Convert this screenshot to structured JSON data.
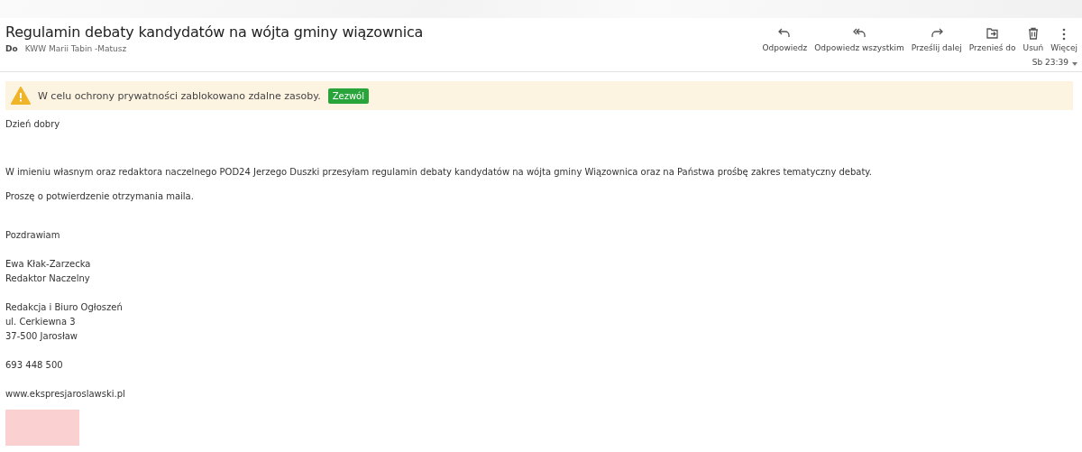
{
  "subject": "Regulamin debaty kandydatów na wójta gminy wiązownica",
  "recipient": {
    "label": "Do",
    "name": "KWW Marii Tabin -Matusz"
  },
  "actions": [
    {
      "kind": "reply",
      "label": "Odpowiedz"
    },
    {
      "kind": "reply_all",
      "label": "Odpowiedz wszystkim"
    },
    {
      "kind": "forward",
      "label": "Prześlij dalej"
    },
    {
      "kind": "move",
      "label": "Przenieś do"
    },
    {
      "kind": "delete",
      "label": "Usuń"
    },
    {
      "kind": "more",
      "label": "Więcej"
    }
  ],
  "date": "Sb 23:39",
  "notice": {
    "text": "W celu ochrony prywatności zablokowano zdalne zasoby.",
    "button": "Zezwól"
  },
  "body": [
    {
      "kind": "normal",
      "lines": [
        "Dzień dobry"
      ]
    },
    {
      "kind": "extra",
      "lines": [
        "W imieniu własnym oraz redaktora naczelnego POD24 Jerzego Duszki przesyłam regulamin debaty kandydatów na wójta gminy Wiązownica oraz na Państwa prośbę zakres tematyczny debaty."
      ]
    },
    {
      "kind": "tight",
      "lines": [
        "Proszę o potwierdzenie otrzymania maila."
      ]
    },
    {
      "kind": "wide",
      "lines": [
        "Pozdrawiam"
      ]
    },
    {
      "kind": "normal",
      "lines": [
        "Ewa Kłak-Zarzecka",
        "Redaktor Naczelny"
      ]
    },
    {
      "kind": "normal",
      "lines": [
        "Redakcja i Biuro Ogłoszeń",
        "ul. Cerkiewna 3",
        "37-500 Jarosław"
      ]
    },
    {
      "kind": "normal",
      "lines": [
        "693 448 500"
      ]
    },
    {
      "kind": "normal",
      "lines": [
        "www.ekspresjaroslawski.pl"
      ]
    }
  ],
  "attachment_image": {
    "kind": "blocked"
  }
}
